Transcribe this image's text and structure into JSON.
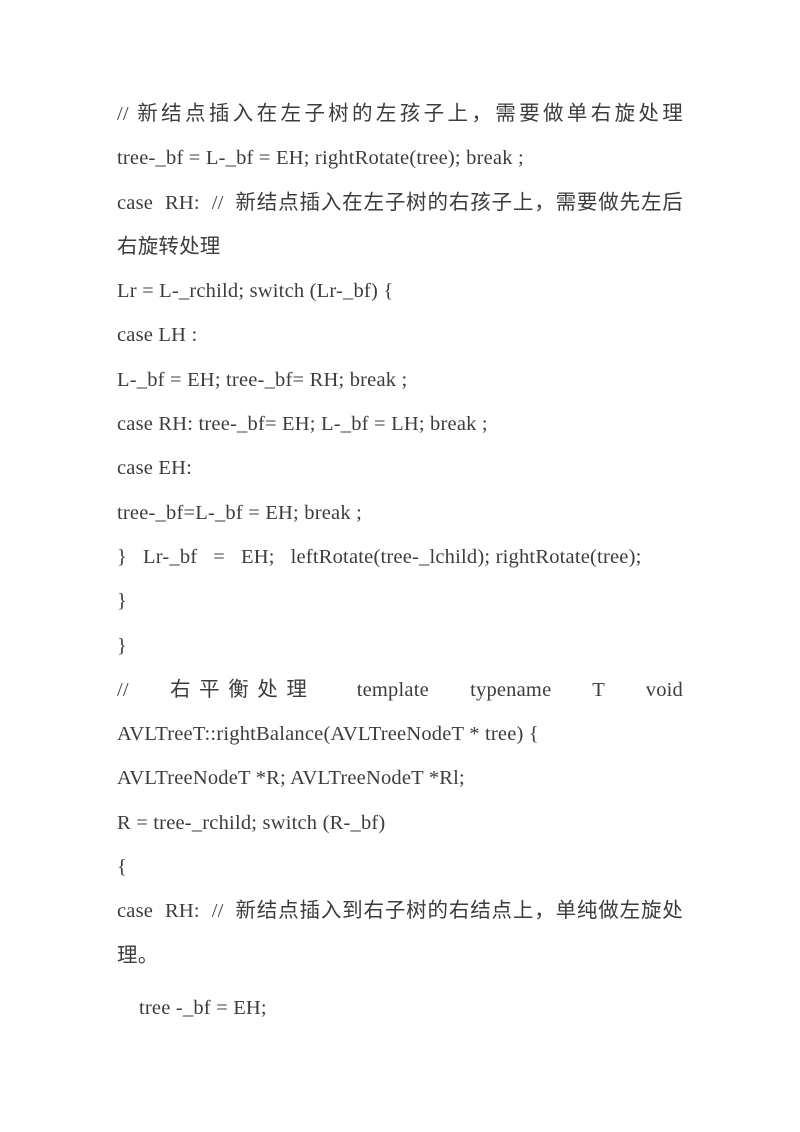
{
  "page": {
    "background_color": "#ffffff",
    "text_color": "#3c3c3c",
    "document_type": "scanned-code-listing"
  },
  "content": {
    "lines": [
      {
        "id": "line-1",
        "text": "// 新结点插入在左子树的左孩子上，需要做单右旋处理",
        "style": "justify"
      },
      {
        "id": "line-2",
        "text": "tree-_bf = L-_bf = EH; rightRotate(tree); break ;",
        "style": "plain"
      },
      {
        "id": "line-3",
        "text": "case  RH:  //  新结点插入在左子树的右孩子上，需要做先左后右旋转处理",
        "style": "wrap"
      },
      {
        "id": "line-4",
        "text": "Lr = L-_rchild; switch (Lr-_bf) {",
        "style": "plain"
      },
      {
        "id": "line-5",
        "text": "case LH :",
        "style": "plain"
      },
      {
        "id": "line-6",
        "text": "L-_bf = EH; tree-_bf= RH; break ;",
        "style": "plain"
      },
      {
        "id": "line-7",
        "text": "case RH: tree-_bf= EH; L-_bf = LH; break ;",
        "style": "plain"
      },
      {
        "id": "line-8",
        "text": "case EH:",
        "style": "plain"
      },
      {
        "id": "line-9",
        "text": "tree-_bf=L-_bf = EH; break ;",
        "style": "plain"
      },
      {
        "id": "line-10",
        "text": "}   Lr-_bf   =   EH;   leftRotate(tree-_lchild); rightRotate(tree);",
        "style": "wrap"
      },
      {
        "id": "line-11",
        "text": "}",
        "style": "plain"
      },
      {
        "id": "line-12",
        "text": "}",
        "style": "plain"
      },
      {
        "id": "line-13",
        "text": "//   右平衡处理   template   typename   T   void AVLTreeT::rightBalance(AVLTreeNodeT * tree) {",
        "style": "wrap"
      },
      {
        "id": "line-14",
        "text": "AVLTreeNodeT *R; AVLTreeNodeT *Rl;",
        "style": "plain"
      },
      {
        "id": "line-15",
        "text": "R = tree-_rchild; switch (R-_bf)",
        "style": "plain"
      },
      {
        "id": "line-16",
        "text": "{",
        "style": "plain"
      },
      {
        "id": "line-17",
        "text": "case  RH:  //  新结点插入到右子树的右结点上，单纯做左旋处理。",
        "style": "wrap"
      },
      {
        "id": "line-18",
        "text": "tree -_bf = EH;",
        "style": "indent-gap"
      }
    ]
  }
}
